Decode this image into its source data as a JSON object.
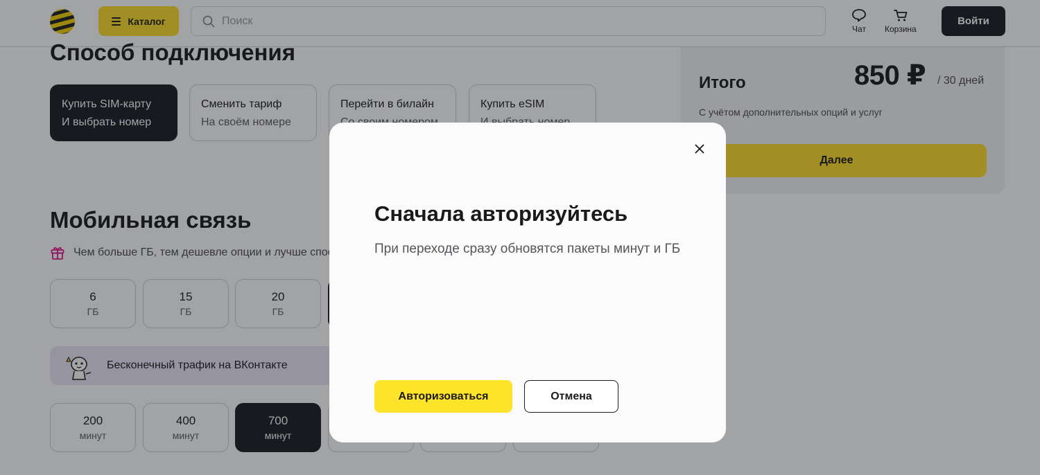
{
  "header": {
    "catalog_label": "Каталог",
    "search_placeholder": "Поиск",
    "chat_label": "Чат",
    "cart_label": "Корзина",
    "login_label": "Войти"
  },
  "connection": {
    "title": "Способ подключения",
    "options": [
      {
        "title": "Купить SIM-карту",
        "subtitle": "И выбрать номер",
        "selected": true
      },
      {
        "title": "Сменить тариф",
        "subtitle": "На своём номере",
        "selected": false
      },
      {
        "title": "Перейти в билайн",
        "subtitle": "Со своим номером",
        "selected": false
      },
      {
        "title": "Купить eSIM",
        "subtitle": "И выбрать номер",
        "selected": false
      }
    ]
  },
  "total": {
    "label": "Итого",
    "price": "850 ₽",
    "period": "/ 30 дней",
    "note": "С учётом дополнительных опций и услуг",
    "next_label": "Далее"
  },
  "mobile": {
    "title": "Мобильная связь",
    "gift_text": "Чем больше ГБ, тем дешевле опции и лучше спос",
    "gb_options": [
      {
        "value": "6",
        "unit": "ГБ"
      },
      {
        "value": "15",
        "unit": "ГБ"
      },
      {
        "value": "20",
        "unit": "ГБ"
      }
    ],
    "vk_banner": "Бесконечный трафик на ВКонтакте",
    "minute_options": [
      {
        "value": "200",
        "unit": "минут",
        "selected": false
      },
      {
        "value": "400",
        "unit": "минут",
        "selected": false
      },
      {
        "value": "700",
        "unit": "минут",
        "selected": true
      }
    ]
  },
  "modal": {
    "title": "Сначала авторизуйтесь",
    "text": "При переходе сразу обновятся пакеты минут и ГБ",
    "auth_label": "Авторизоваться",
    "cancel_label": "Отмена"
  },
  "colors": {
    "brand_yellow": "#fedc2a",
    "dark": "#191c22",
    "overlay": "#17191e"
  }
}
